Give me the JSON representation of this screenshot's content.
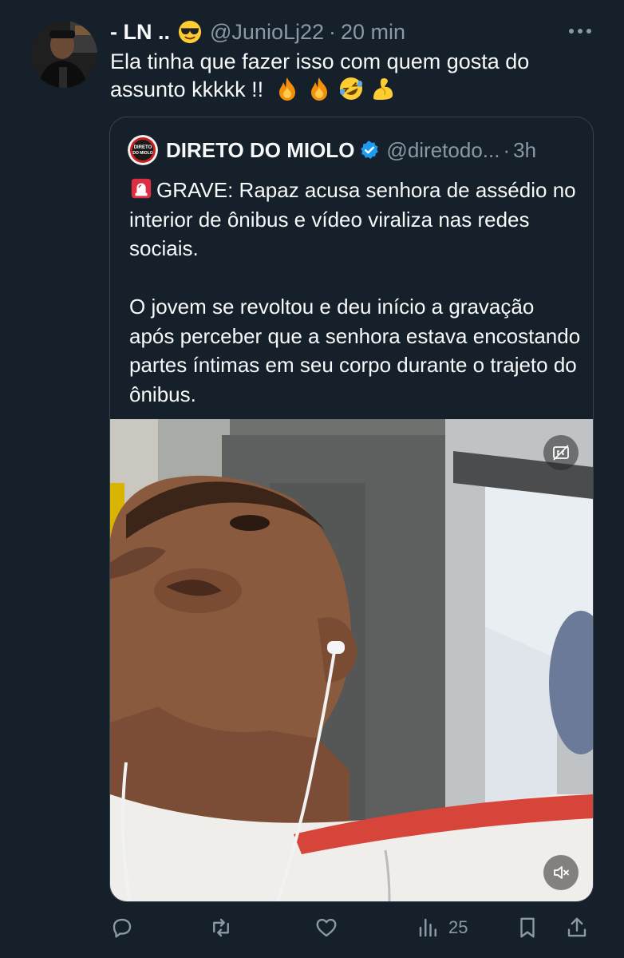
{
  "tweet": {
    "display_name": "- LN ..",
    "name_emoji": "sunglasses-emoji",
    "handle": "@JunioLj22",
    "separator": "·",
    "time": "20 min",
    "text": "Ela tinha que fazer isso com quem gosta do assunto kkkkk !!",
    "trailing_emojis": [
      "fire-emoji",
      "fire-emoji",
      "rofl-emoji",
      "flexed-biceps-emoji"
    ]
  },
  "quote": {
    "avatar_text_line1": "DIRETO",
    "avatar_text_line2": "DO MIOLO",
    "name": "DIRETO DO MIOLO",
    "verified": true,
    "handle": "@diretodo...",
    "separator": "·",
    "time": "3h",
    "paragraph1": "GRAVE: Rapaz acusa senhora de assédio no interior de ônibus e vídeo viraliza nas redes sociais.",
    "paragraph1_emoji": "rotating-light-emoji",
    "paragraph2": "O jovem se revoltou e deu início a gravação após perceber que a senhora estava encostando partes íntimas em seu corpo durante o trajeto do ônibus.",
    "video": {
      "captions_button": "captions-off-icon",
      "mute_button": "volume-muted-icon"
    }
  },
  "actions": {
    "reply": {
      "icon": "reply-icon"
    },
    "retweet": {
      "icon": "retweet-icon"
    },
    "like": {
      "icon": "heart-icon"
    },
    "views": {
      "icon": "views-chart-icon",
      "count": "25"
    },
    "bookmark": {
      "icon": "bookmark-icon"
    },
    "share": {
      "icon": "share-icon"
    }
  },
  "colors": {
    "background": "#15202b",
    "primary_text": "#f7f9f9",
    "secondary_text": "#8b98a5",
    "border": "#38444d",
    "verified_blue": "#1d9bf0"
  }
}
